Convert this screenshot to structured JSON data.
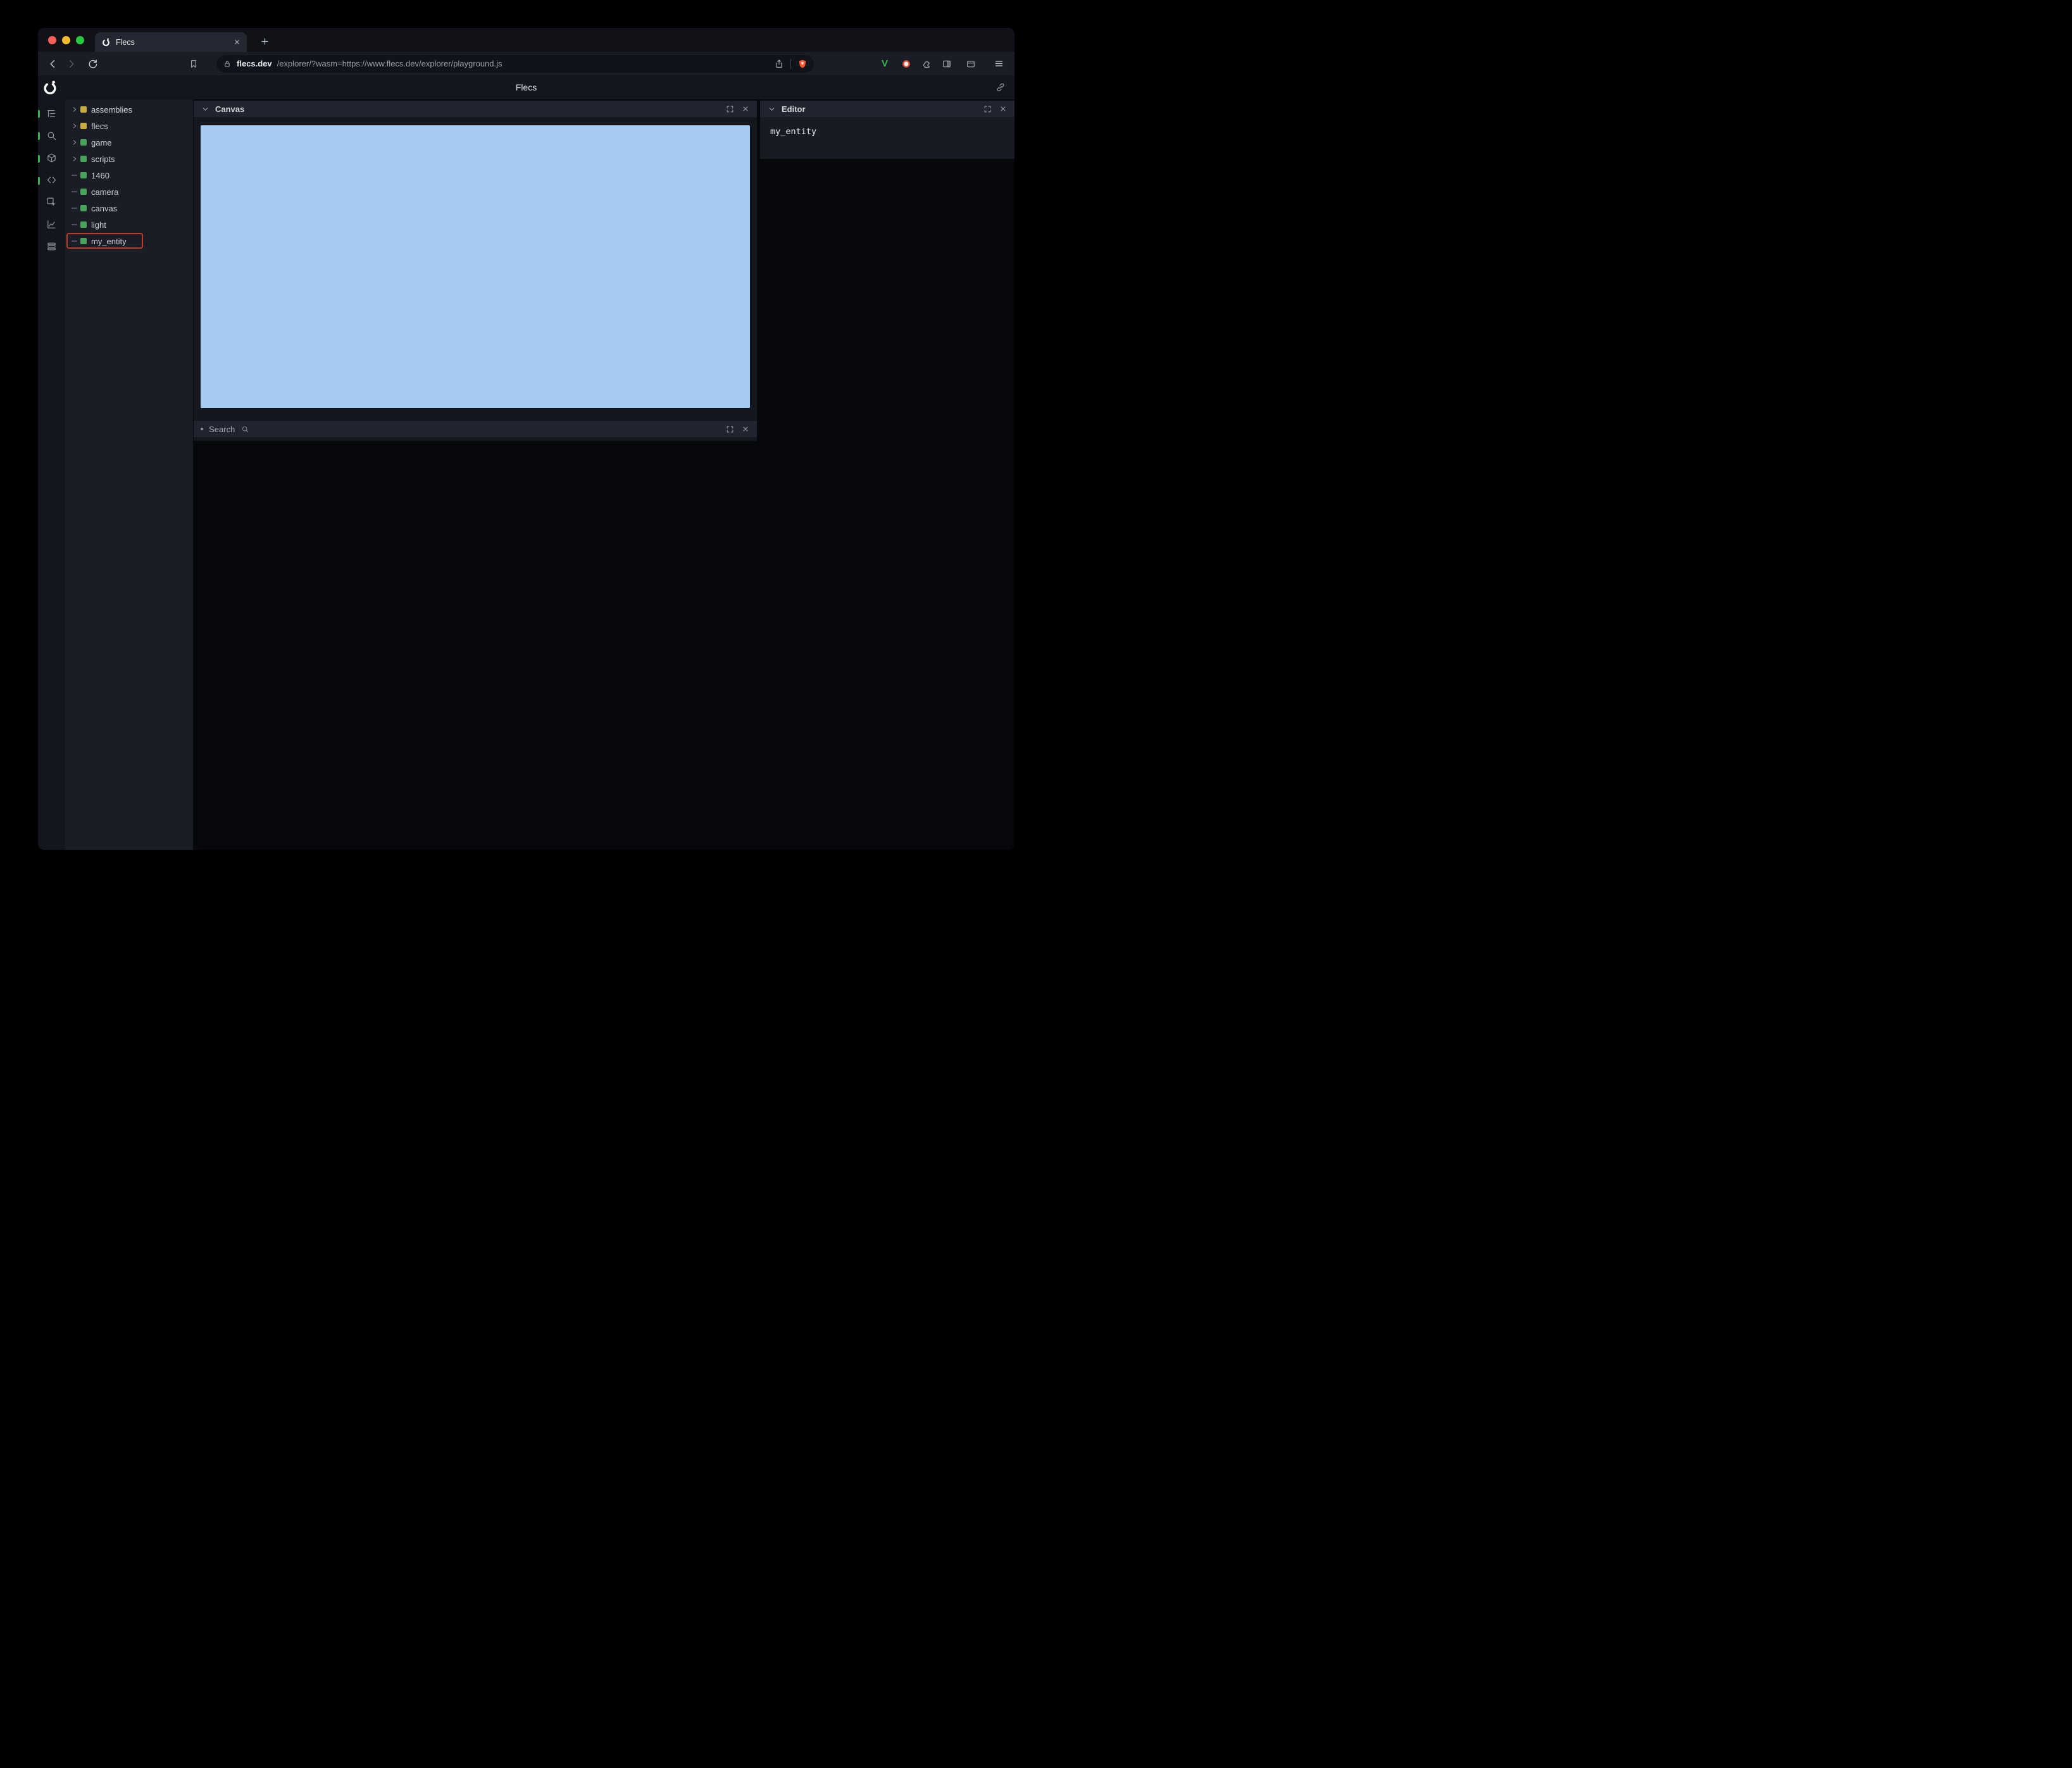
{
  "browser": {
    "tab_title": "Flecs",
    "url": {
      "host": "flecs.dev",
      "path": "/explorer/?wasm=https://www.flecs.dev/explorer/playground.js"
    }
  },
  "app": {
    "header_title": "Flecs",
    "tree": {
      "items": [
        {
          "label": "assemblies",
          "color": "#c9ad3d",
          "expandable": true
        },
        {
          "label": "flecs",
          "color": "#c9ad3d",
          "expandable": true
        },
        {
          "label": "game",
          "color": "#47a65c",
          "expandable": true
        },
        {
          "label": "scripts",
          "color": "#47a65c",
          "expandable": true
        },
        {
          "label": "1460",
          "color": "#47a65c",
          "expandable": false
        },
        {
          "label": "camera",
          "color": "#47a65c",
          "expandable": false
        },
        {
          "label": "canvas",
          "color": "#47a65c",
          "expandable": false
        },
        {
          "label": "light",
          "color": "#47a65c",
          "expandable": false
        },
        {
          "label": "my_entity",
          "color": "#47a65c",
          "expandable": false,
          "annotated": true
        }
      ]
    },
    "panels": {
      "canvas": {
        "title": "Canvas",
        "canvas_color": "#a5cbf0"
      },
      "search": {
        "title": "Search"
      },
      "editor": {
        "title": "Editor",
        "content": "my_entity"
      }
    },
    "colors": {
      "annotation_red": "#c43b25",
      "active_indicator_green": "#3fae53",
      "entity_green": "#47a65c",
      "module_yellow": "#c9ad3d"
    }
  }
}
